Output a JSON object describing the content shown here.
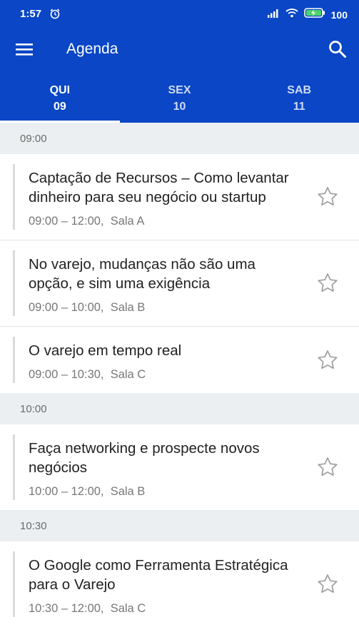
{
  "status": {
    "time": "1:57",
    "battery": "100"
  },
  "appbar": {
    "title": "Agenda"
  },
  "tabs": [
    {
      "dow": "QUI",
      "day": "09",
      "active": true
    },
    {
      "dow": "SEX",
      "day": "10",
      "active": false
    },
    {
      "dow": "SAB",
      "day": "11",
      "active": false
    }
  ],
  "groups": [
    {
      "time": "09:00",
      "items": [
        {
          "title": "Captação de Recursos – Como levantar dinheiro para seu negócio ou startup",
          "time": "09:00 – 12:00,",
          "room": "Sala A"
        },
        {
          "title": "No varejo, mudanças não são uma opção, e sim uma exigência",
          "time": "09:00 – 10:00,",
          "room": "Sala B"
        },
        {
          "title": "O varejo em tempo real",
          "time": "09:00 – 10:30,",
          "room": "Sala C"
        }
      ]
    },
    {
      "time": "10:00",
      "items": [
        {
          "title": "Faça networking e prospecte novos negócios",
          "time": "10:00 – 12:00,",
          "room": "Sala B"
        }
      ]
    },
    {
      "time": "10:30",
      "items": [
        {
          "title": "O Google como Ferramenta Estratégica para o Varejo",
          "time": "10:30 – 12:00,",
          "room": "Sala C"
        }
      ]
    }
  ]
}
